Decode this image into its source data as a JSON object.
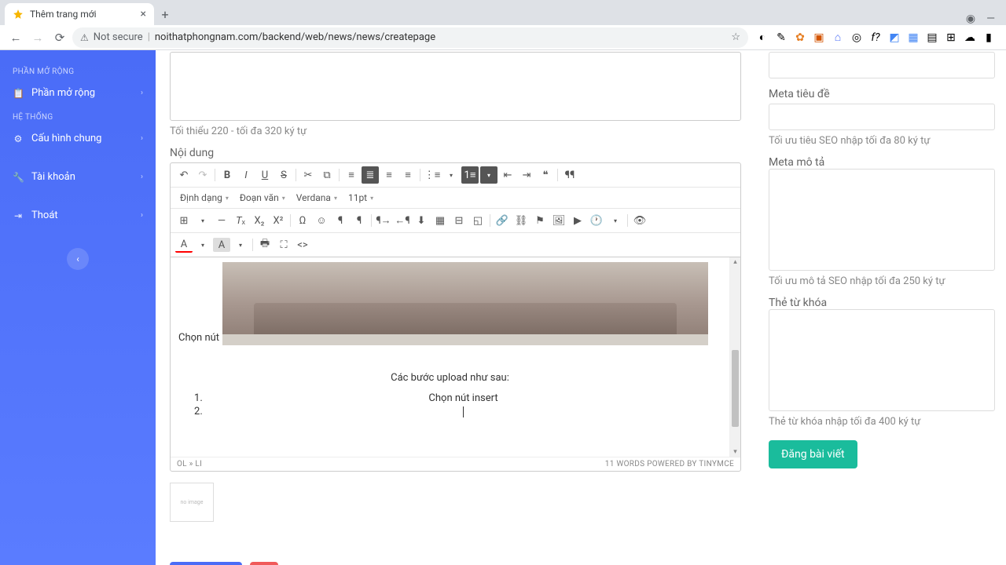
{
  "browser": {
    "tab_title": "Thêm trang mới",
    "not_secure": "Not secure",
    "url": "noithatphongnam.com/backend/web/news/news/createpage"
  },
  "sidebar": {
    "section_ext": "PHẦN MỞ RỘNG",
    "item_ext": "Phần mở rộng",
    "section_sys": "HỆ THỐNG",
    "item_config": "Cấu hình chung",
    "item_account": "Tài khoản",
    "item_logout": "Thoát"
  },
  "main": {
    "summary_hint": "Tối thiểu 220 - tối đa 320 ký tự",
    "content_label": "Nội dung",
    "format_label": "Định dạng",
    "para_label": "Đoạn văn",
    "font_label": "Verdana",
    "size_label": "11pt",
    "body_prefix": "Chọn nút",
    "step_title": "Các bước upload như sau:",
    "li1": "Chọn nút insert",
    "path": "OL » LI",
    "status_right": "11 WORDS POWERED BY TINYMCE",
    "thumb_placeholder": "no image"
  },
  "right": {
    "meta_title_label": "Meta tiêu đề",
    "meta_title_hint": "Tối ưu tiêu SEO nhập tối đa 80 ký tự",
    "meta_desc_label": "Meta mô tả",
    "meta_desc_hint": "Tối ưu mô tả SEO nhập tối đa 250 ký tự",
    "keyword_label": "Thẻ từ khóa",
    "keyword_hint": "Thẻ từ khóa nhập tối đa 400 ký tự",
    "publish": "Đăng bài viết"
  }
}
